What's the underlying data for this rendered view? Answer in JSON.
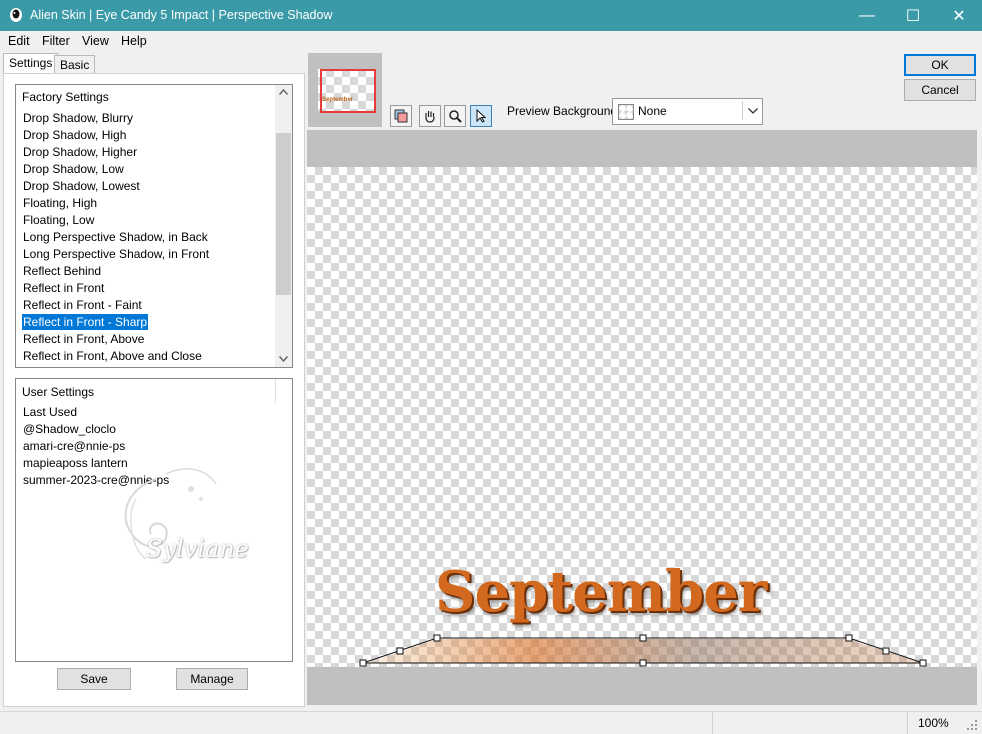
{
  "window": {
    "title": "Alien Skin | Eye Candy 5 Impact | Perspective Shadow",
    "minimize": "—",
    "maximize": "☐",
    "close": "✕"
  },
  "menu": {
    "items": [
      "Edit",
      "Filter",
      "View",
      "Help"
    ]
  },
  "tabs": [
    "Settings",
    "Basic"
  ],
  "factory": {
    "header": "Factory Settings",
    "items": [
      "Drop Shadow, Blurry",
      "Drop Shadow, High",
      "Drop Shadow, Higher",
      "Drop Shadow, Low",
      "Drop Shadow, Lowest",
      "Floating, High",
      "Floating, Low",
      "Long Perspective Shadow, in Back",
      "Long Perspective Shadow, in Front",
      "Reflect Behind",
      "Reflect in Front",
      "Reflect in Front - Faint",
      "Reflect in Front - Sharp",
      "Reflect in Front, Above",
      "Reflect in Front, Above and Close"
    ],
    "selected_index": 12
  },
  "user": {
    "header": "User Settings",
    "items": [
      "Last Used",
      "@Shadow_cloclo",
      "amari-cre@nnie-ps",
      "mapieaposs lantern",
      "summer-2023-cre@nnie-ps"
    ]
  },
  "watermark": {
    "text": "Sylviane"
  },
  "buttons": {
    "save": "Save",
    "manage": "Manage",
    "ok": "OK",
    "cancel": "Cancel"
  },
  "preview": {
    "background_label": "Preview Background:",
    "background_value": "None",
    "text": "September",
    "thumb_text": "September"
  },
  "status": {
    "zoom": "100%"
  },
  "colors": {
    "titlebar": "#3a9aa8",
    "selection": "#0078d7"
  }
}
